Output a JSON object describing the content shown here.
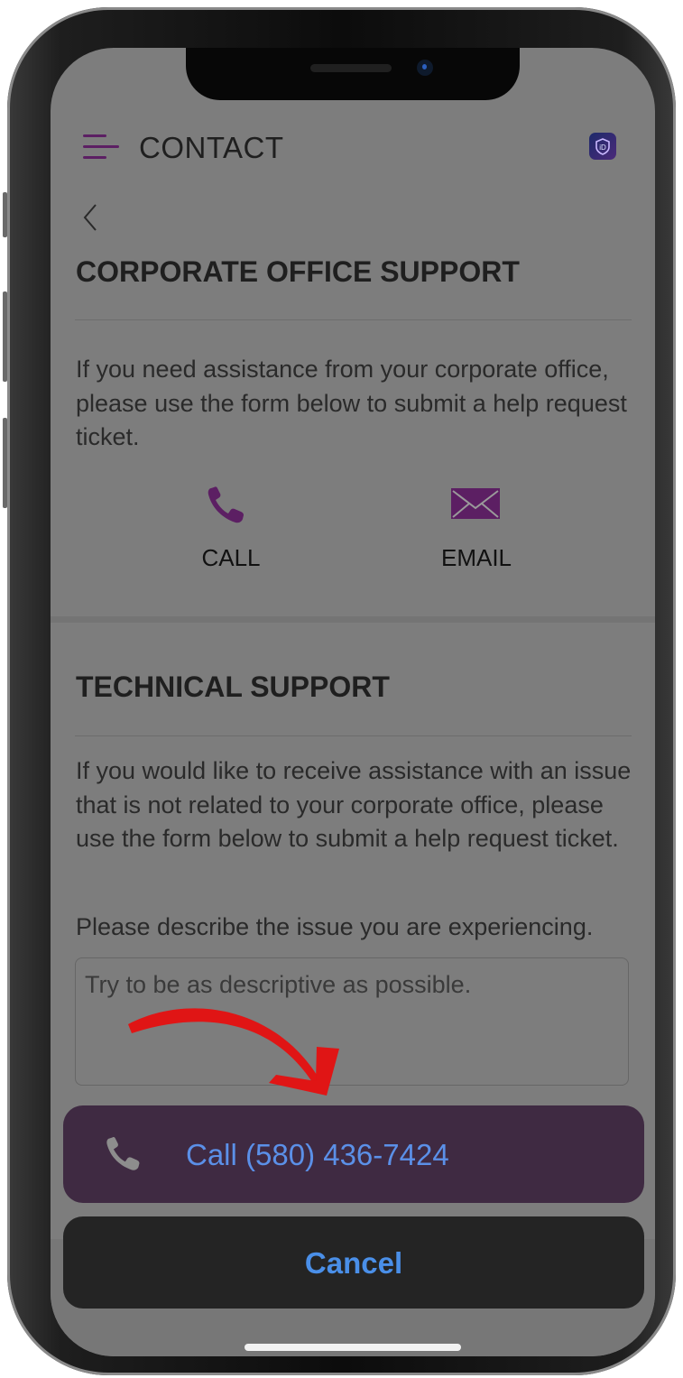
{
  "header": {
    "title": "CONTACT",
    "menu_icon": "hamburger-menu-icon",
    "badge_icon": "app-shield-icon"
  },
  "corporate": {
    "title": "CORPORATE OFFICE SUPPORT",
    "description": "If you need assistance from your corporate office, please use the form below to submit a help request ticket.",
    "call_label": "CALL",
    "email_label": "EMAIL"
  },
  "technical": {
    "title": "TECHNICAL SUPPORT",
    "description": "If you would like to receive assistance with an issue that is not related to your corporate office, please use the form below to submit a help request ticket.",
    "prompt": "Please describe the issue you are experiencing.",
    "placeholder": "Try to be as descriptive as possible."
  },
  "action_sheet": {
    "call_label": "Call (580) 436-7424",
    "cancel_label": "Cancel"
  },
  "colors": {
    "accent_purple": "#5c1f63",
    "ios_blue": "#4a8fe8",
    "arrow_red": "#e01515"
  }
}
